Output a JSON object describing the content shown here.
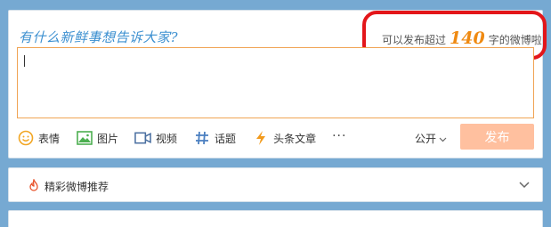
{
  "composer": {
    "prompt": "有什么新鲜事想告诉大家?",
    "limit_prefix": "可以发布超过",
    "limit_number": "140",
    "limit_suffix": "字的微博啦",
    "textarea_value": ""
  },
  "toolbar": {
    "items": [
      {
        "label": "表情",
        "icon": "smiley-icon"
      },
      {
        "label": "图片",
        "icon": "image-icon"
      },
      {
        "label": "视频",
        "icon": "video-icon"
      },
      {
        "label": "话题",
        "icon": "hashtag-icon"
      },
      {
        "label": "头条文章",
        "icon": "lightning-icon"
      }
    ],
    "more": "···",
    "visibility": "公开",
    "post_button": "发布"
  },
  "recommendation": {
    "label": "精彩微博推荐"
  },
  "colors": {
    "accent": "#ef8a12",
    "highlight_border": "#e3161a",
    "post_button_bg": "#ffc09f",
    "prompt_text": "#3b8fd0",
    "background": "#76a9d2"
  }
}
